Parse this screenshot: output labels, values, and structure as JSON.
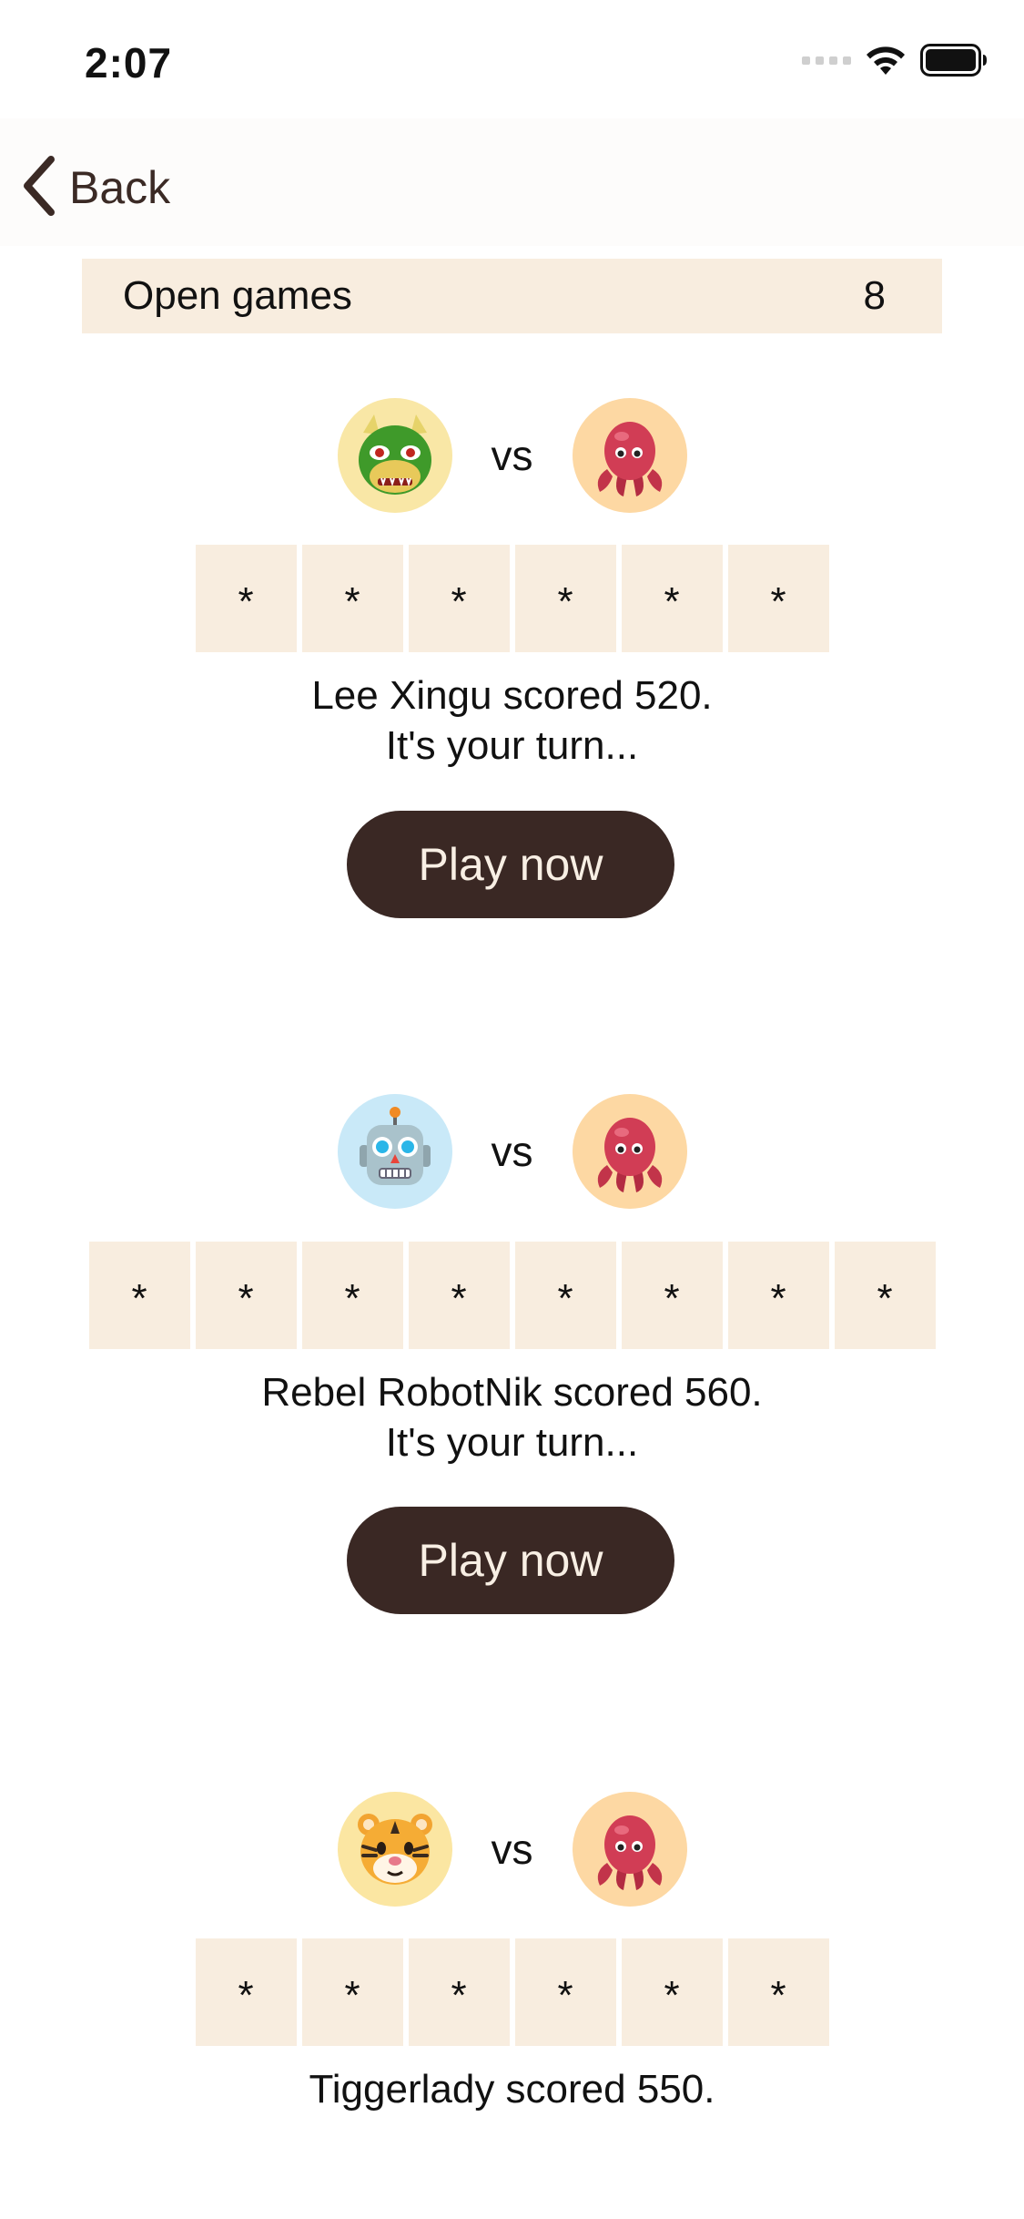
{
  "status_bar": {
    "time": "2:07"
  },
  "nav": {
    "back_label": "Back"
  },
  "section": {
    "title": "Open games",
    "count": "8"
  },
  "games": [
    {
      "opponent_avatar": "dragon-face-icon",
      "player_avatar": "octopus-icon",
      "vs": "vs",
      "tiles": [
        "*",
        "*",
        "*",
        "*",
        "*",
        "*"
      ],
      "score_line": "Lee Xingu scored 520.",
      "turn_line": "It's your turn...",
      "button_label": "Play now"
    },
    {
      "opponent_avatar": "robot-face-icon",
      "player_avatar": "octopus-icon",
      "vs": "vs",
      "tiles": [
        "*",
        "*",
        "*",
        "*",
        "*",
        "*",
        "*",
        "*"
      ],
      "score_line": "Rebel RobotNik scored 560.",
      "turn_line": "It's your turn...",
      "button_label": "Play now"
    },
    {
      "opponent_avatar": "tiger-face-icon",
      "player_avatar": "octopus-icon",
      "vs": "vs",
      "tiles": [
        "*",
        "*",
        "*",
        "*",
        "*",
        "*"
      ],
      "score_line": "Tiggerlady scored 550."
    }
  ],
  "colors": {
    "accent_dark": "#3a2824",
    "tile_background": "#f8eddf",
    "button_text": "#f8efe4"
  }
}
